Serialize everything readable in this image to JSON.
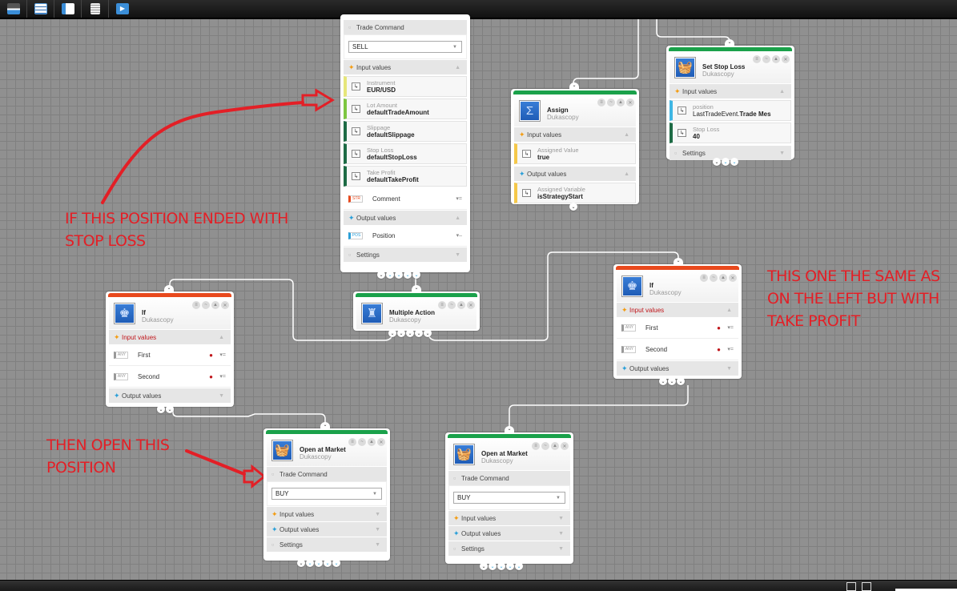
{
  "toolbar": {
    "buttons": [
      {
        "name": "save"
      },
      {
        "name": "properties"
      },
      {
        "name": "add-block"
      },
      {
        "name": "new-document"
      },
      {
        "name": "run"
      }
    ]
  },
  "nodes": {
    "open_sell": {
      "trade_command_label": "Trade Command",
      "trade_command_value": "SELL",
      "input_label": "Input values",
      "inputs": [
        {
          "label": "Instrument",
          "value": "EUR/USD",
          "color": "#e6e67a"
        },
        {
          "label": "Lot Amount",
          "value": "defaultTradeAmount",
          "color": "#7dc640"
        },
        {
          "label": "Slippage",
          "value": "defaultSlippage",
          "color": "#1d6b45"
        },
        {
          "label": "Stop Loss",
          "value": "defaultStopLoss",
          "color": "#1d6b45"
        },
        {
          "label": "Take Profit",
          "value": "defaultTakeProfit",
          "color": "#1d6b45"
        }
      ],
      "comment_tag": "STR",
      "comment_label": "Comment",
      "output_label": "Output values",
      "position_tag": "POS",
      "position_label": "Position",
      "settings_label": "Settings"
    },
    "assign": {
      "title": "Assign",
      "vendor": "Dukascopy",
      "input_label": "Input values",
      "in_label": "Assigned Value",
      "in_value": "true",
      "output_label": "Output values",
      "out_label": "Assigned Variable",
      "out_value": "isStrategyStart"
    },
    "set_stop_loss": {
      "title": "Set Stop Loss",
      "vendor": "Dukascopy",
      "input_label": "Input values",
      "pos_label": "position",
      "pos_value_a": "LastTradeEvent.",
      "pos_value_b": "Trade Mes",
      "sl_label": "Stop Loss",
      "sl_value": "40",
      "settings_label": "Settings"
    },
    "if_left": {
      "title": "If",
      "vendor": "Dukascopy",
      "input_label": "Input values",
      "first": "First",
      "second": "Second",
      "tag": "ANY",
      "output_label": "Output values"
    },
    "multiple_action": {
      "title": "Multiple Action",
      "vendor": "Dukascopy"
    },
    "if_right": {
      "title": "If",
      "vendor": "Dukascopy",
      "input_label": "Input values",
      "first": "First",
      "second": "Second",
      "tag": "ANY",
      "output_label": "Output values"
    },
    "open_buy_left": {
      "title": "Open at Market",
      "vendor": "Dukascopy",
      "trade_command_label": "Trade Command",
      "trade_command_value": "BUY",
      "input_label": "Input values",
      "output_label": "Output values",
      "settings_label": "Settings"
    },
    "open_buy_right": {
      "title": "Open at Market",
      "vendor": "Dukascopy",
      "trade_command_label": "Trade Command",
      "trade_command_value": "BUY",
      "input_label": "Input values",
      "output_label": "Output values",
      "settings_label": "Settings"
    }
  },
  "annotations": {
    "stop_loss_note_1": "IF THIS POSITION ENDED WITH",
    "stop_loss_note_2": "STOP LOSS",
    "open_note_1": "THEN OPEN THIS",
    "open_note_2": "POSITION",
    "take_profit_note_1": "THIS ONE THE SAME AS",
    "take_profit_note_2": "ON THE LEFT BUT WITH",
    "take_profit_note_3": "TAKE PROFIT"
  },
  "colors": {
    "annotation": "#e31f26",
    "header_green": "#1aa14a",
    "header_red": "#e8491d",
    "icon_blue": "#2a6fc9"
  }
}
